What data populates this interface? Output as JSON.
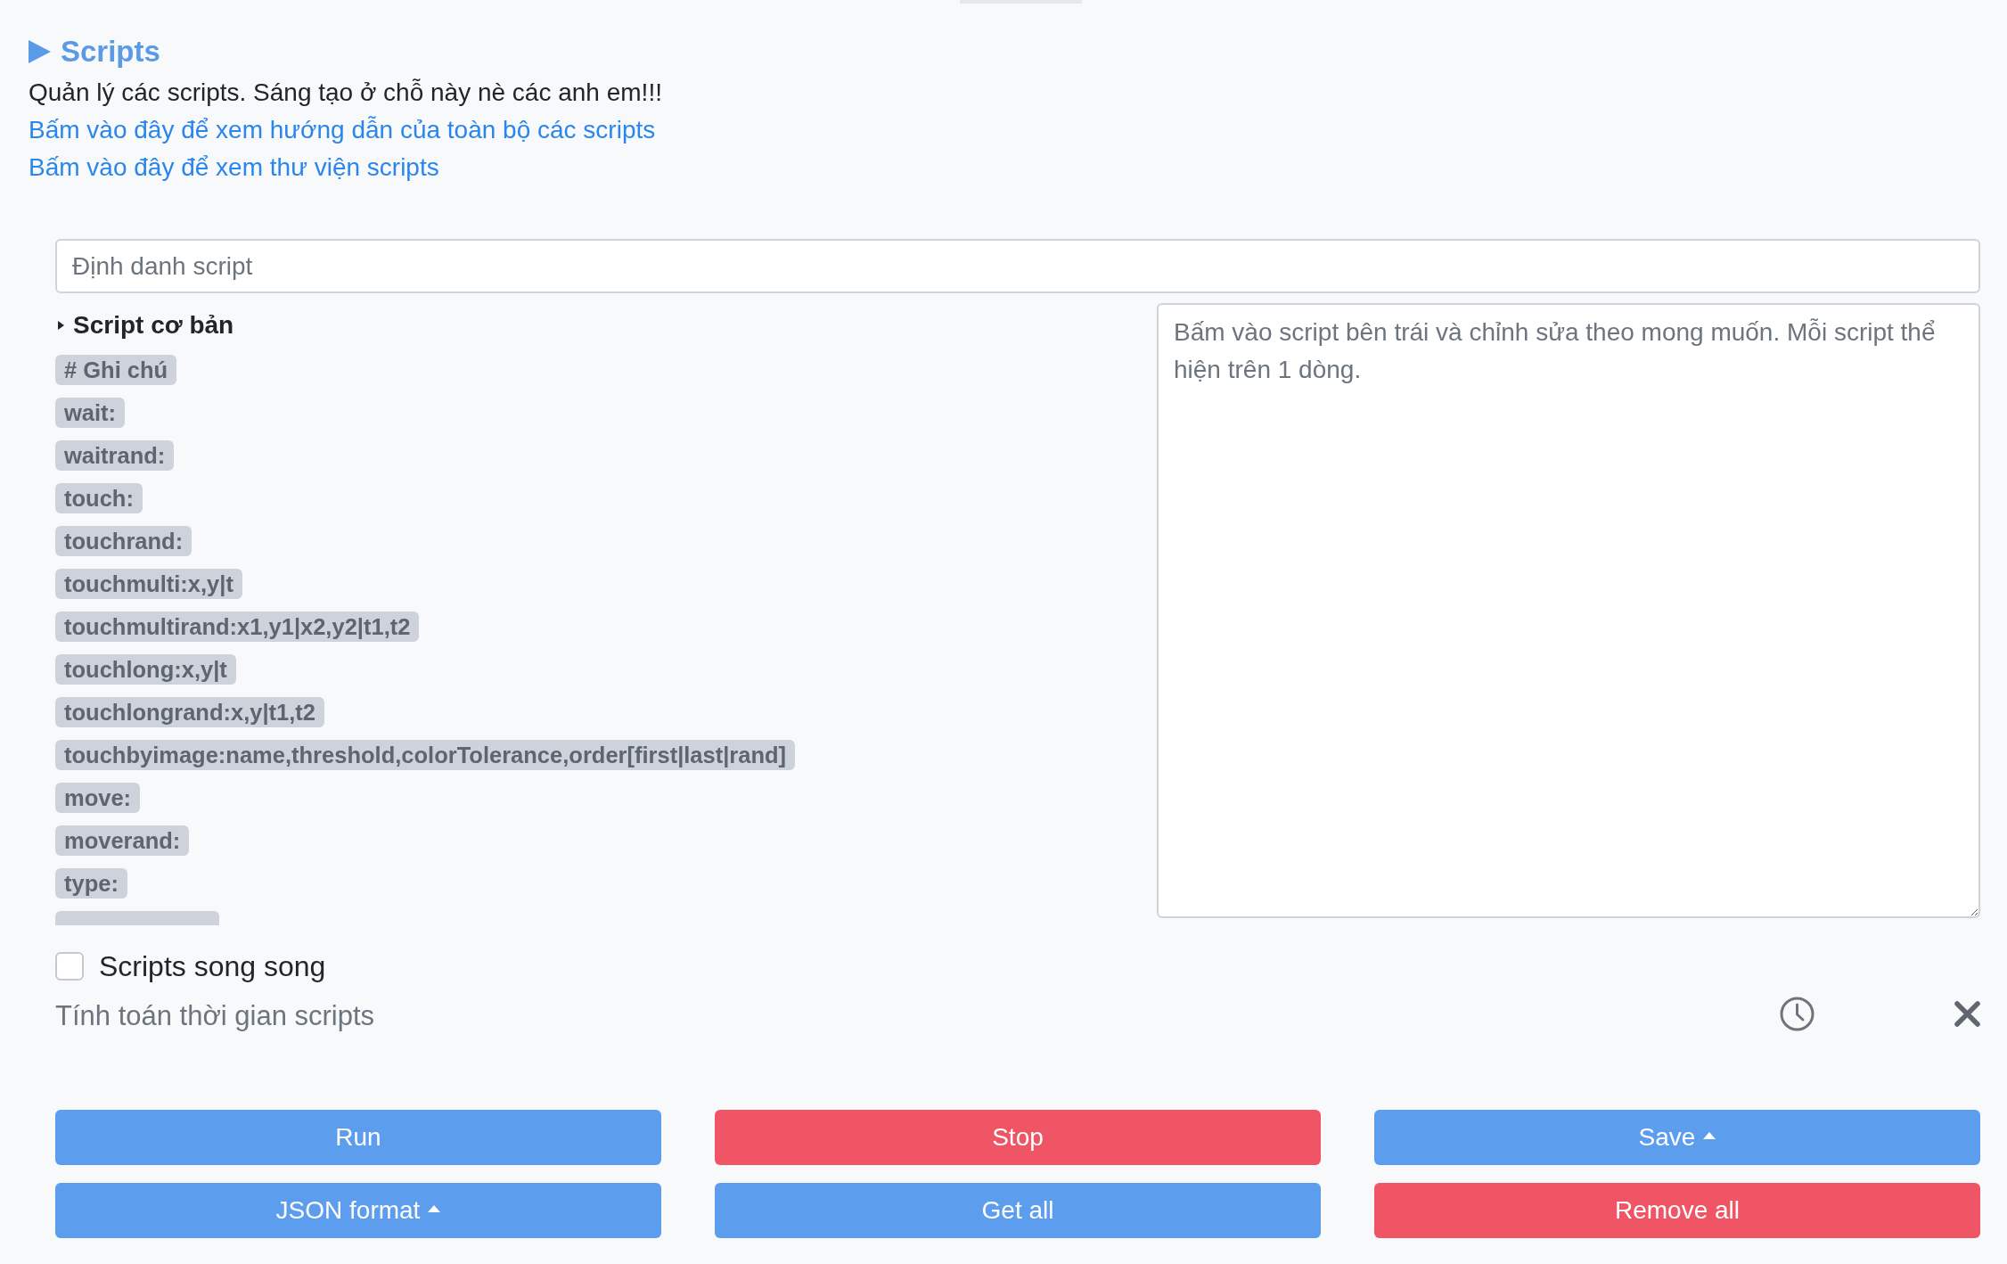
{
  "header": {
    "title": "Scripts",
    "description": "Quản lý các scripts. Sáng tạo ở chỗ này nè các anh em!!!",
    "links": [
      "Bấm vào đây để xem hướng dẫn của toàn bộ các scripts",
      "Bấm vào đây để xem thư viện scripts"
    ]
  },
  "name_field": {
    "placeholder": "Định danh script"
  },
  "script_list": {
    "group_title": "Script cơ bản",
    "items": [
      "# Ghi chú",
      "wait:",
      "waitrand:",
      "touch:",
      "touchrand:",
      "touchmulti:x,y|t",
      "touchmultirand:x1,y1|x2,y2|t1,t2",
      "touchlong:x,y|t",
      "touchlongrand:x,y|t1,t2",
      "touchbyimage:name,threshold,colorTolerance,order[first|last|rand]",
      "move:",
      "moverand:",
      "type:"
    ]
  },
  "editor": {
    "placeholder": "Bấm vào script bên trái và chỉnh sửa theo mong muốn. Mỗi script thể hiện trên 1 dòng."
  },
  "parallel_option": {
    "label": "Scripts song song",
    "checked": false
  },
  "timing": {
    "label": "Tính toán thời gian scripts"
  },
  "buttons": [
    {
      "label": "Run",
      "kind": "primary",
      "caret": false
    },
    {
      "label": "Stop",
      "kind": "danger",
      "caret": false
    },
    {
      "label": "Save",
      "kind": "primary",
      "caret": true
    },
    {
      "label": "JSON format",
      "kind": "primary",
      "caret": true
    },
    {
      "label": "Get all",
      "kind": "primary",
      "caret": false
    },
    {
      "label": "Remove all",
      "kind": "danger",
      "caret": false
    }
  ]
}
